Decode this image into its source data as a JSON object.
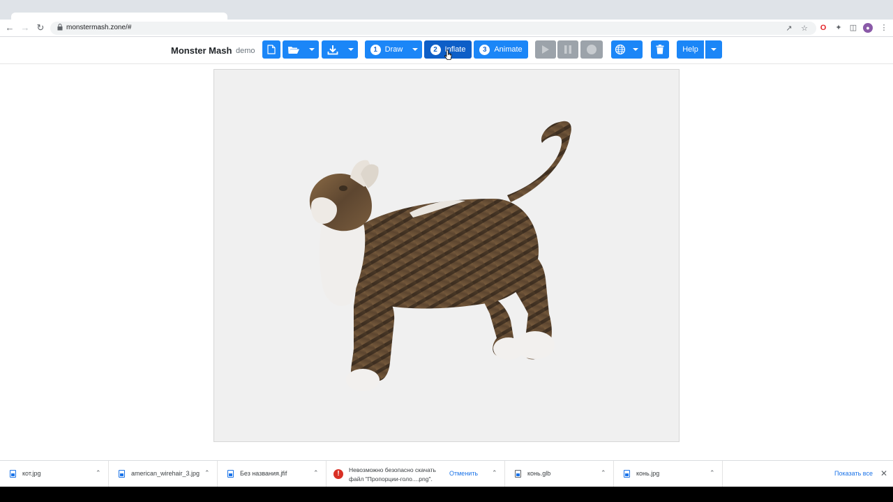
{
  "browser": {
    "url": "monstermash.zone/#"
  },
  "app": {
    "brand": "Monster Mash",
    "brand_sub": "demo",
    "steps": [
      {
        "num": "1",
        "label": "Draw"
      },
      {
        "num": "2",
        "label": "Inflate"
      },
      {
        "num": "3",
        "label": "Animate"
      }
    ],
    "help_label": "Help",
    "active_step": "Inflate"
  },
  "downloads": {
    "items": [
      {
        "name": "кот.jpg"
      },
      {
        "name": "american_wirehair_3.jpg"
      },
      {
        "name": "Без названия.jfif"
      },
      {
        "name": "конь.glb"
      },
      {
        "name": "конь.jpg"
      }
    ],
    "warning_line1": "Невозможно безопасно скачать",
    "warning_line2": "файл \"Пропорции-голо....png\".",
    "cancel_label": "Отменить",
    "show_all_label": "Показать все"
  },
  "colors": {
    "primary": "#1b86f7",
    "primary_active": "#0d5ec7",
    "disabled": "#9ca3aa",
    "canvas_bg": "#f0f0f0"
  }
}
